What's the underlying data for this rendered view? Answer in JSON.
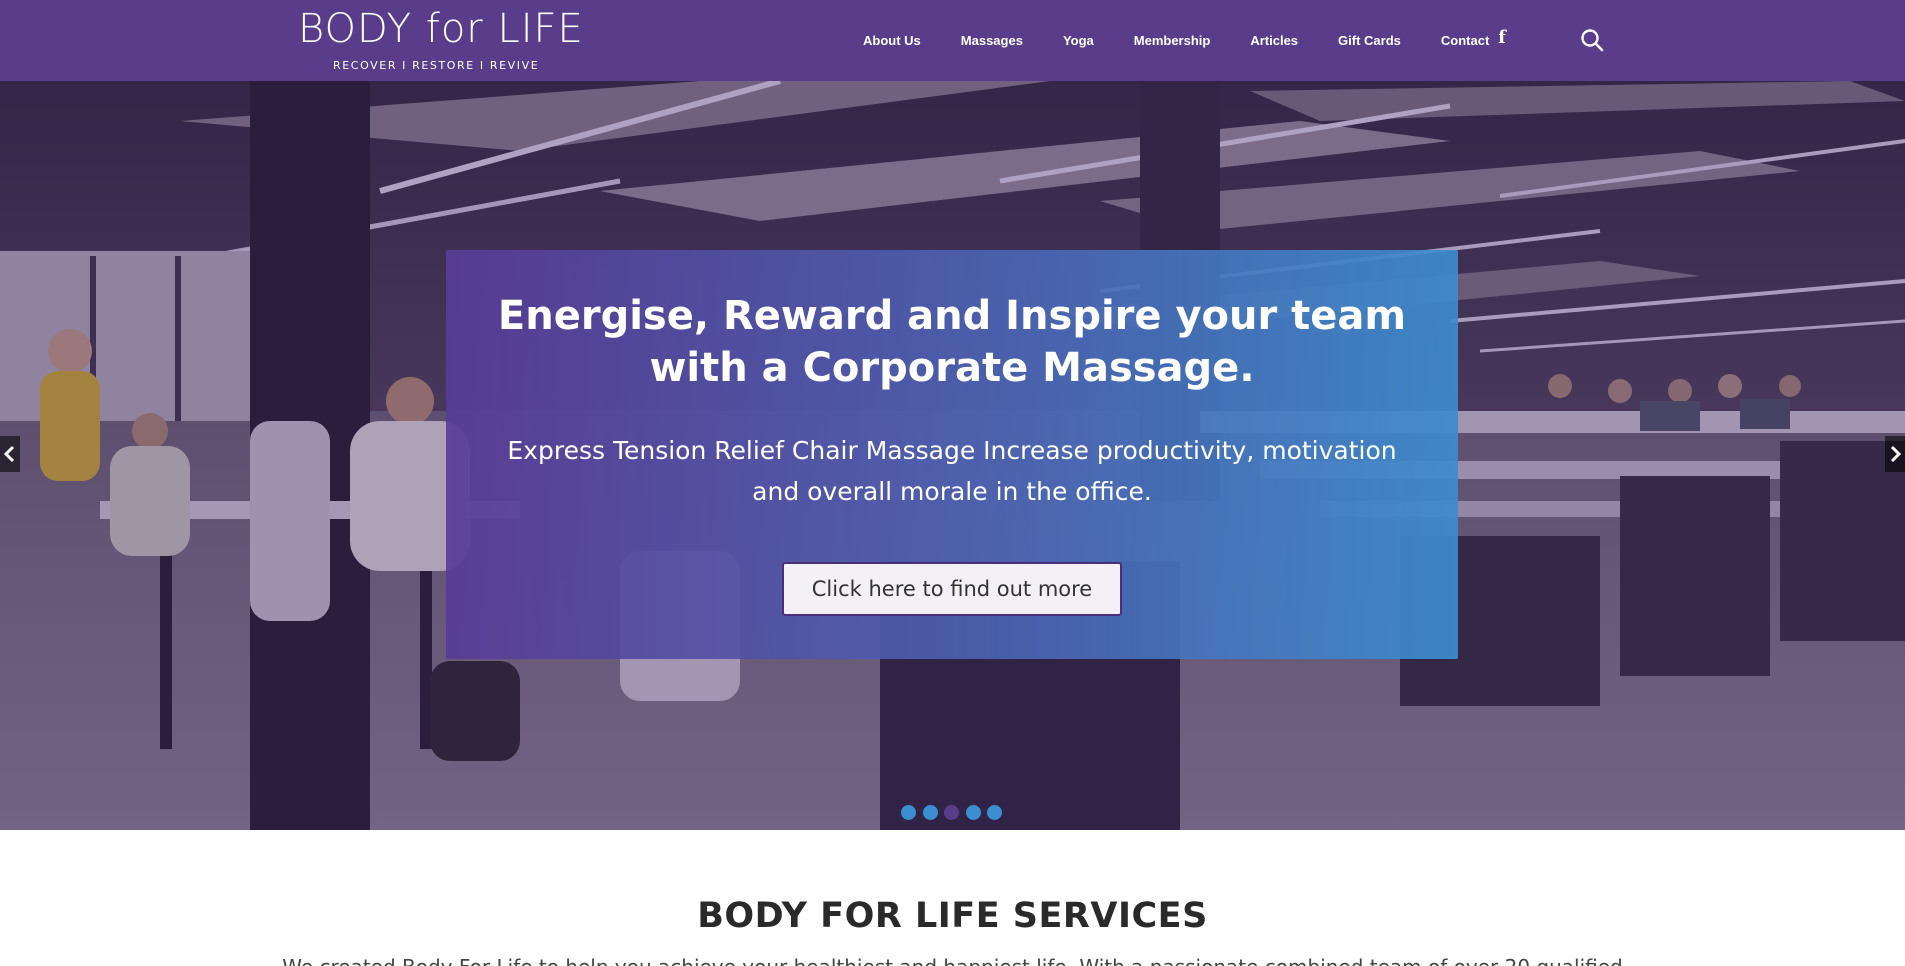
{
  "header": {
    "logo_text": "BODY for LIFE",
    "logo_tagline": "RECOVER  I  RESTORE  I  REVIVE",
    "nav": [
      {
        "label": "About Us"
      },
      {
        "label": "Massages"
      },
      {
        "label": "Yoga"
      },
      {
        "label": "Membership"
      },
      {
        "label": "Articles"
      },
      {
        "label": "Gift Cards"
      },
      {
        "label": "Contact"
      }
    ],
    "facebook_icon": "facebook-icon",
    "search_icon": "search-icon",
    "brand_color": "#5a3d8a"
  },
  "hero": {
    "title": "Energise, Reward and Inspire your team with a Corporate Massage.",
    "text": "Express Tension Relief Chair Massage Increase productivity, motivation and overall morale in the office.",
    "cta_label": "Click here to find out more",
    "prev_icon": "chevron-left-icon",
    "next_icon": "chevron-right-icon",
    "slides_count": 5,
    "active_slide": 3,
    "accent_color": "#3a8dd1"
  },
  "services": {
    "title": "BODY FOR LIFE SERVICES",
    "text": "We created Body For Life to help you achieve your healthiest and happiest life. With a passionate combined team of over 20 qualified"
  }
}
